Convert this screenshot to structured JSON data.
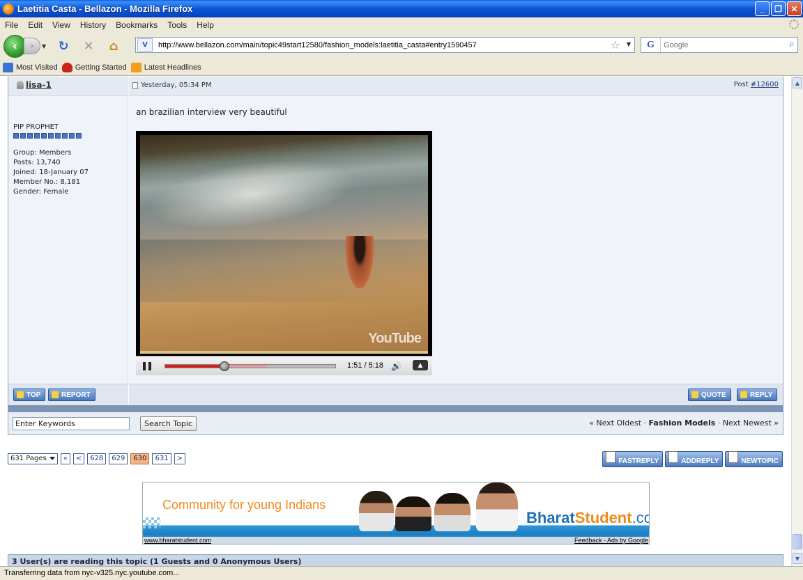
{
  "window": {
    "title": "Laetitia Casta - Bellazon - Mozilla Firefox",
    "minimize": "_",
    "maximize": "❐",
    "close": "✕"
  },
  "menu": [
    "File",
    "Edit",
    "View",
    "History",
    "Bookmarks",
    "Tools",
    "Help"
  ],
  "nav": {
    "url": "http://www.bellazon.com/main/topic49start12580/fashion_models:laetitia_casta#entry1590457",
    "search_placeholder": "Google"
  },
  "bookmarks": [
    "Most Visited",
    "Getting Started",
    "Latest Headlines"
  ],
  "post": {
    "username": "lisa-1",
    "timestamp": "Yesterday, 05:34 PM",
    "post_label": "Post ",
    "post_number": "#12600",
    "rank": "PIP PROPHET",
    "pips": 10,
    "group": "Group: Members",
    "posts": "Posts: 13,740",
    "joined": "Joined: 18-January 07",
    "member_no": "Member No.: 8,181",
    "gender": "Gender: Female",
    "body": "an brazilian interview very beautiful",
    "video": {
      "time": "1:51 / 5:18",
      "played_fraction": 0.349,
      "buffered_fraction": 0.6,
      "watermark": "YouTube"
    },
    "buttons": {
      "top": "TOP",
      "report": "REPORT",
      "quote": "QUOTE",
      "reply": "REPLY"
    }
  },
  "topic_search": {
    "keywords_value": "Enter Keywords",
    "search_button": "Search Topic",
    "prev": "« Next Oldest · ",
    "forum": "Fashion Models",
    "next": " · Next Newest »"
  },
  "pagination": {
    "total": "631 Pages",
    "first": "«",
    "prev": "<",
    "pages": [
      "628",
      "629",
      "630",
      "631"
    ],
    "current": "630",
    "next": ">"
  },
  "reply_buttons": [
    "FASTREPLY",
    "ADDREPLY",
    "NEWTOPIC"
  ],
  "ad": {
    "tagline": "Community for young Indians",
    "brand_a": "Bharat",
    "brand_b": "Student",
    "brand_c": ".com",
    "site_link": "www.bharatstudent.com",
    "feedback": "Feedback - Ads by Google"
  },
  "readers": "3 User(s) are reading this topic (1 Guests and 0 Anonymous Users)",
  "status": "Transferring data from nyc-v325.nyc.youtube.com..."
}
